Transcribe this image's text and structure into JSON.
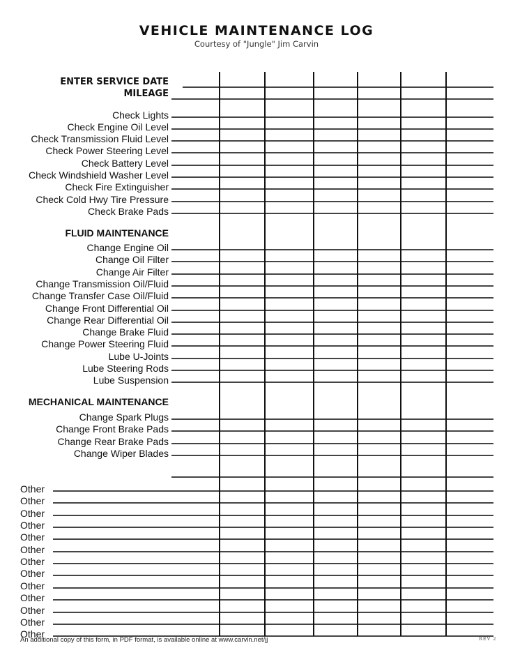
{
  "header": {
    "title": "VEHICLE MAINTENANCE LOG",
    "subtitle": "Courtesy of \"Jungle\" Jim Carvin"
  },
  "form": {
    "service_date_label": "ENTER SERVICE DATE",
    "mileage_label": "MILEAGE",
    "column_count": 6,
    "checks": [
      "Check Lights",
      "Check Engine Oil Level",
      "Check Transmission Fluid Level",
      "Check Power Steering Level",
      "Check Battery Level",
      "Check Windshield Washer Level",
      "Check Fire Extinguisher",
      "Check Cold Hwy Tire Pressure",
      "Check Brake Pads"
    ],
    "fluid_section": "FLUID MAINTENANCE",
    "fluid": [
      "Change Engine Oil",
      "Change Oil Filter",
      "Change Air Filter",
      "Change Transmission Oil/Fluid",
      "Change Transfer Case Oil/Fluid",
      "Change Front Differential Oil",
      "Change Rear Differential Oil",
      "Change Brake Fluid",
      "Change Power Steering Fluid",
      "Lube U-Joints",
      "Lube Steering Rods",
      "Lube Suspension"
    ],
    "mechanical_section": "MECHANICAL MAINTENANCE",
    "mechanical": [
      "Change Spark Plugs",
      "Change Front Brake Pads",
      "Change Rear Brake Pads",
      "Change Wiper Blades"
    ],
    "other_label": "Other",
    "other_count": 13
  },
  "footer": {
    "note": "An additional copy of this form, in PDF format, is available online at www.carvin.net/jj",
    "revision": "REV 2"
  }
}
